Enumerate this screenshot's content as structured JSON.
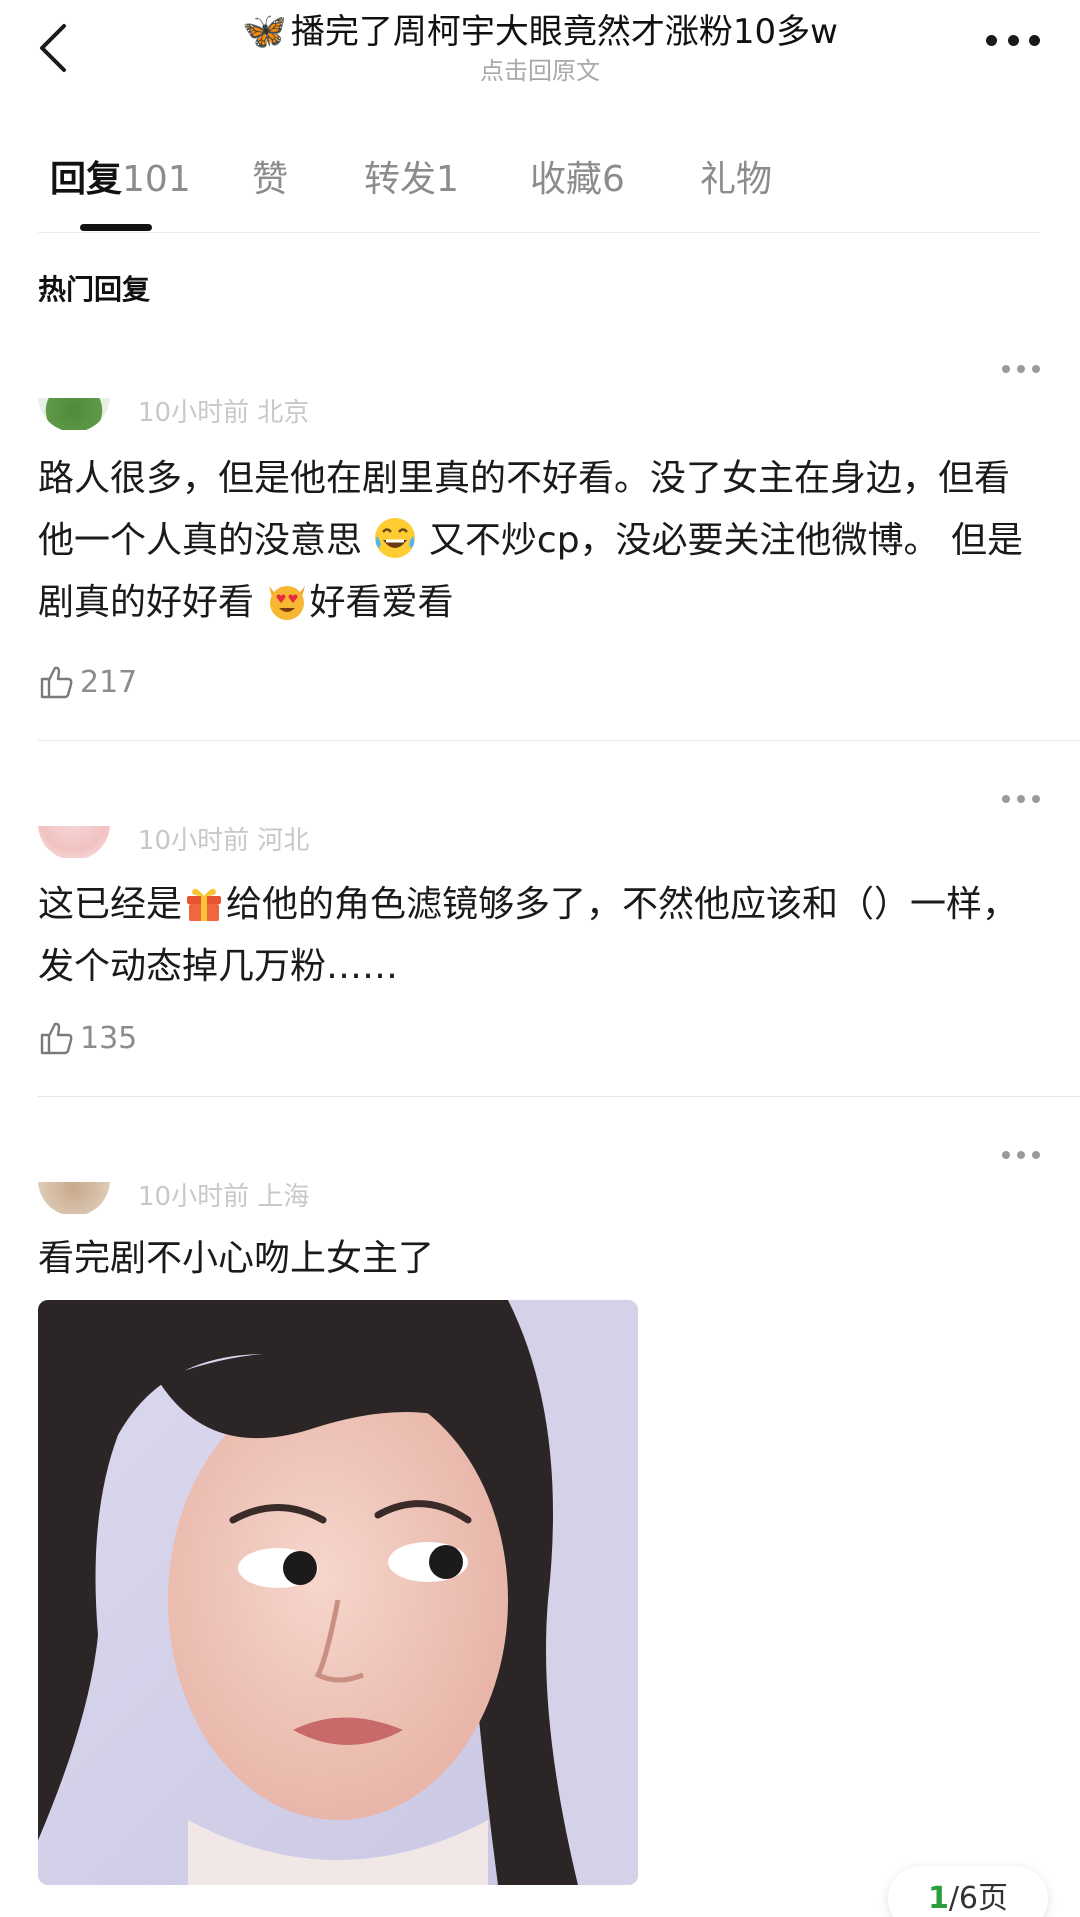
{
  "header": {
    "title_emoji": "🦋",
    "title": "播完了周柯宇大眼竟然才涨粉10多w",
    "subtitle": "点击回原文"
  },
  "tabs": [
    {
      "label": "回复",
      "count": "101",
      "active": true
    },
    {
      "label": "赞",
      "count": "",
      "active": false
    },
    {
      "label": "转发",
      "count": "1",
      "active": false
    },
    {
      "label": "收藏",
      "count": "6",
      "active": false
    },
    {
      "label": "礼物",
      "count": "",
      "active": false
    }
  ],
  "section_title": "热门回复",
  "comments": [
    {
      "meta": "10小时前 北京",
      "text_parts": [
        "路人很多，但是他在剧里真的不好看。没了女主在身边，但看他一个人真的没意思",
        " 又不炒cp，没必要关注他微博。 但是剧真的好好看",
        "好看爱看"
      ],
      "likes": "217"
    },
    {
      "meta": "10小时前 河北",
      "text_parts": [
        "这已经是",
        "给他的角色滤镜够多了，不然他应该和（）一样，发个动态掉几万粉……"
      ],
      "likes": "135"
    },
    {
      "meta": "10小时前 上海",
      "text_parts": [
        "看完剧不小心吻上女主了"
      ],
      "likes": ""
    }
  ],
  "pager": {
    "current": "1",
    "total_text": "/6页"
  },
  "colors": {
    "accent_green": "#2a9d3d",
    "title_emoji_blue": "#1b8be0"
  }
}
